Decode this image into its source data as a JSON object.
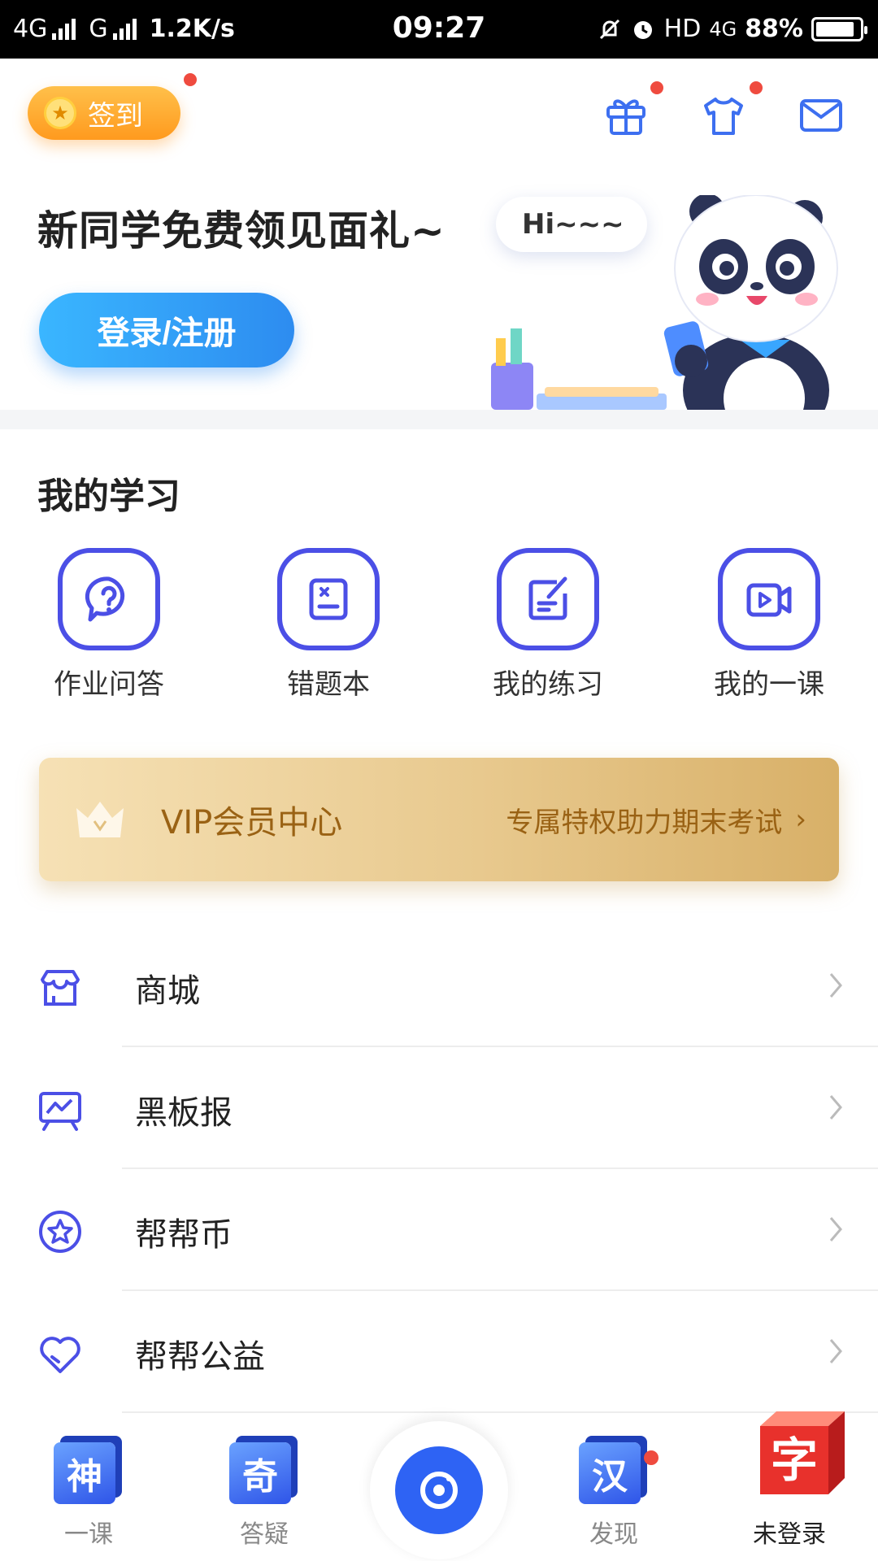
{
  "status_bar": {
    "network1": "4G",
    "network2": "G",
    "speed": "1.2K/s",
    "time": "09:27",
    "hd": "HD",
    "lte": "4G",
    "battery": "88%",
    "battery_level": 0.88
  },
  "header": {
    "signin_label": "签到"
  },
  "hero": {
    "title": "新同学免费领见面礼~",
    "login_button": "登录/注册",
    "bubble_text": "Hi~~~"
  },
  "my_learning": {
    "title": "我的学习",
    "items": [
      {
        "label": "作业问答",
        "icon": "question-chat-icon"
      },
      {
        "label": "错题本",
        "icon": "mistake-book-icon"
      },
      {
        "label": "我的练习",
        "icon": "practice-edit-icon"
      },
      {
        "label": "我的一课",
        "icon": "video-lesson-icon"
      }
    ]
  },
  "vip": {
    "title": "VIP会员中心",
    "subtitle": "专属特权助力期末考试",
    "chevron": "›",
    "color": "#9a6214"
  },
  "menu": {
    "items": [
      {
        "label": "商城",
        "icon": "shop-icon"
      },
      {
        "label": "黑板报",
        "icon": "blackboard-icon"
      },
      {
        "label": "帮帮币",
        "icon": "star-coin-icon"
      },
      {
        "label": "帮帮公益",
        "icon": "heart-icon"
      }
    ]
  },
  "tabbar": {
    "tabs": [
      {
        "label": "一课",
        "glyph": "神"
      },
      {
        "label": "答疑",
        "glyph": "奇"
      },
      {
        "label": "发现",
        "glyph": "汉"
      },
      {
        "label": "未登录",
        "glyph": "字"
      }
    ]
  },
  "colors": {
    "accent": "#4b4fe6",
    "login": "#2d8cf0",
    "signin": "#ff9a1e",
    "badge": "#ef4b3f"
  }
}
